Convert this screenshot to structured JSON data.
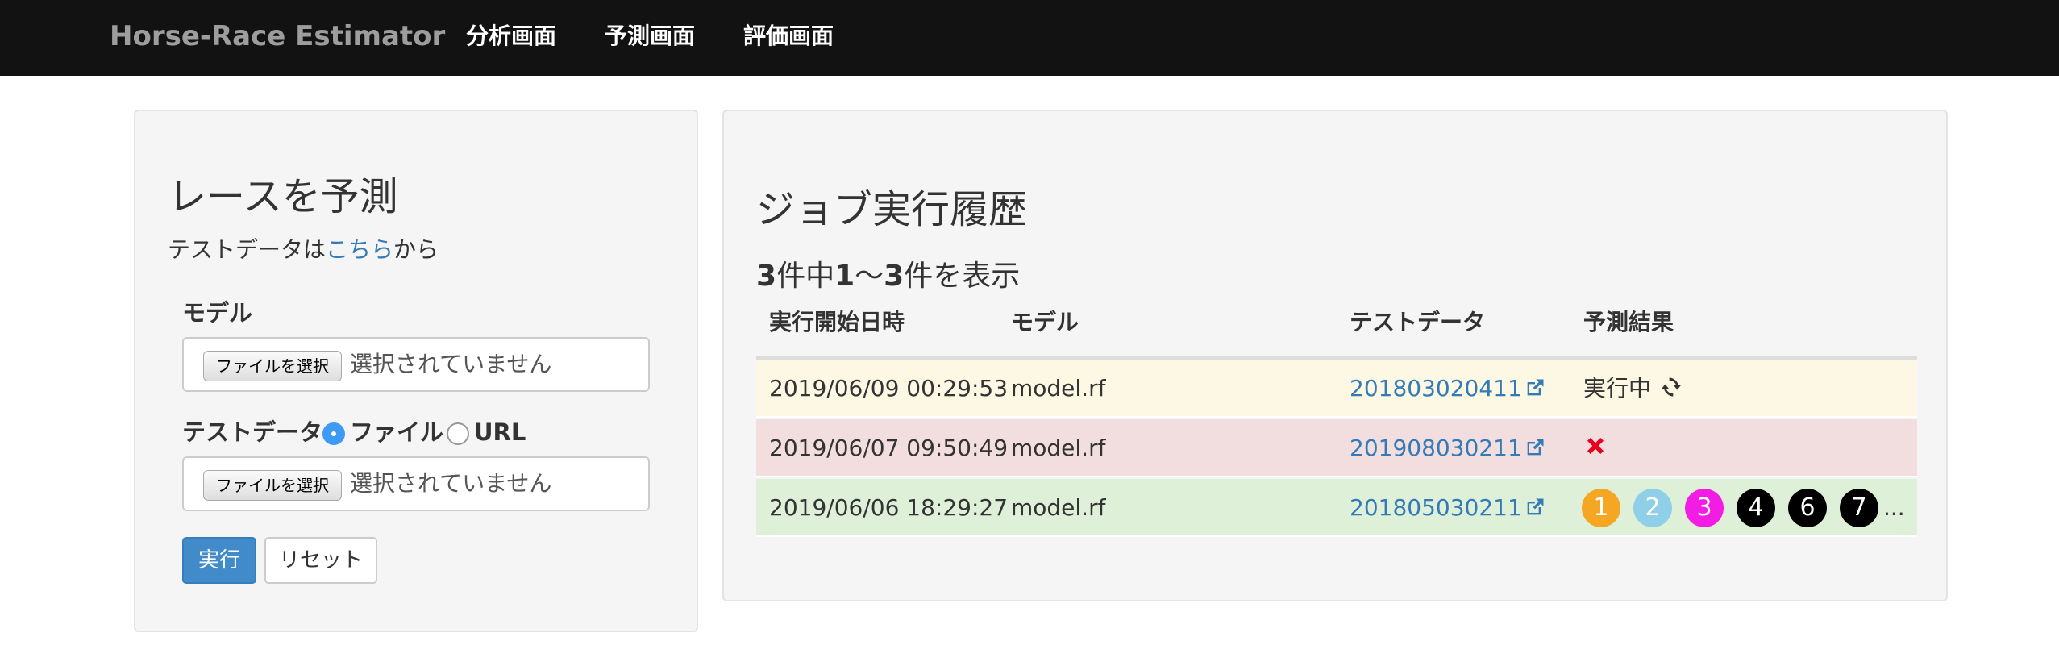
{
  "nav": {
    "brand": "Horse-Race Estimator",
    "items": [
      "分析画面",
      "予測画面",
      "評価画面"
    ]
  },
  "predict_form": {
    "title": "レースを予測",
    "test_data_note_prefix": "テストデータは",
    "test_data_note_link": "こちら",
    "test_data_note_suffix": "から",
    "model_label": "モデル",
    "model_file_button": "ファイルを選択",
    "model_file_status": "選択されていません",
    "test_data_label": "テストデータ",
    "radio_file_label": "ファイル",
    "radio_url_label": "URL",
    "radio_selected": "ファイル",
    "test_file_button": "ファイルを選択",
    "test_file_status": "選択されていません",
    "run_button": "実行",
    "reset_button": "リセット"
  },
  "history": {
    "title": "ジョブ実行履歴",
    "count_total": "3",
    "count_mid": "件中",
    "count_from": "1",
    "count_sep": "〜",
    "count_to": "3",
    "count_suffix": "件を表示",
    "columns": [
      "実行開始日時",
      "モデル",
      "テストデータ",
      "予測結果"
    ],
    "rows": [
      {
        "started_at": "2019/06/09 00:29:53",
        "model": "model.rf",
        "test_data": "201803020411",
        "status": "実行中",
        "status_icon": "refresh-icon",
        "row_color": "#fcf8e3"
      },
      {
        "started_at": "2019/06/07 09:50:49",
        "model": "model.rf",
        "test_data": "201908030211",
        "status_icon": "error-x-icon",
        "row_color": "#f2dede"
      },
      {
        "started_at": "2019/06/06 18:29:27",
        "model": "model.rf",
        "test_data": "201805030211",
        "row_color": "#dff0d8",
        "result_numbers": [
          "1",
          "2",
          "3",
          "4",
          "6",
          "7"
        ],
        "result_colors": [
          "#f5a623",
          "#8fcfe8",
          "#f21ce5",
          "#000000",
          "#000000",
          "#000000"
        ],
        "more": "..."
      }
    ]
  },
  "colors": {
    "navbar": "#121212",
    "link": "#337ab7",
    "primary": "#428bca",
    "error": "#e8001c"
  }
}
